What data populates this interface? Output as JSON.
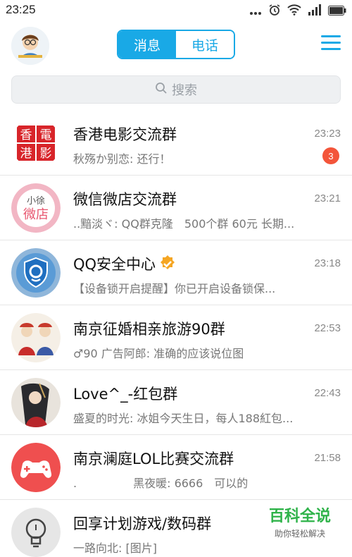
{
  "status_bar": {
    "time": "23:25"
  },
  "header": {
    "tabs": [
      {
        "label": "消息",
        "active": true
      },
      {
        "label": "电话",
        "active": false
      }
    ],
    "accent_color": "#19a9e6"
  },
  "search": {
    "placeholder": "搜索"
  },
  "chats": [
    {
      "name": "香港电影交流群",
      "time": "23:23",
      "preview": "秋殇か别恋: 还行！",
      "unread": "3",
      "avatar_text": "香電港影"
    },
    {
      "name": "微信微店交流群",
      "time": "23:21",
      "preview": "..黯淡ヾ: QQ群克隆　500个群 60元 长期...",
      "avatar_text": "小徐微店"
    },
    {
      "name": "QQ安全中心",
      "time": "23:18",
      "preview": "【设备锁开启提醒】你已开启设备锁保...",
      "verified": true
    },
    {
      "name": "南京征婚相亲旅游90群",
      "time": "22:53",
      "preview": "♂90 广告阿郎: 准确的应该说位图"
    },
    {
      "name": "Love^_-红包群",
      "time": "22:43",
      "preview": "盛夏的时光: 冰姐今天生日，每人188紅包..."
    },
    {
      "name": "南京澜庭LOL比赛交流群",
      "time": "21:58",
      "preview": ".　　　　　黑夜暖: 6666　可以的"
    },
    {
      "name": "回享计划游戏/数码群",
      "time": "6",
      "preview": "一路向北: [图片]"
    }
  ],
  "watermark": {
    "title": "百科全说",
    "subtitle": "助你轻松解决"
  }
}
